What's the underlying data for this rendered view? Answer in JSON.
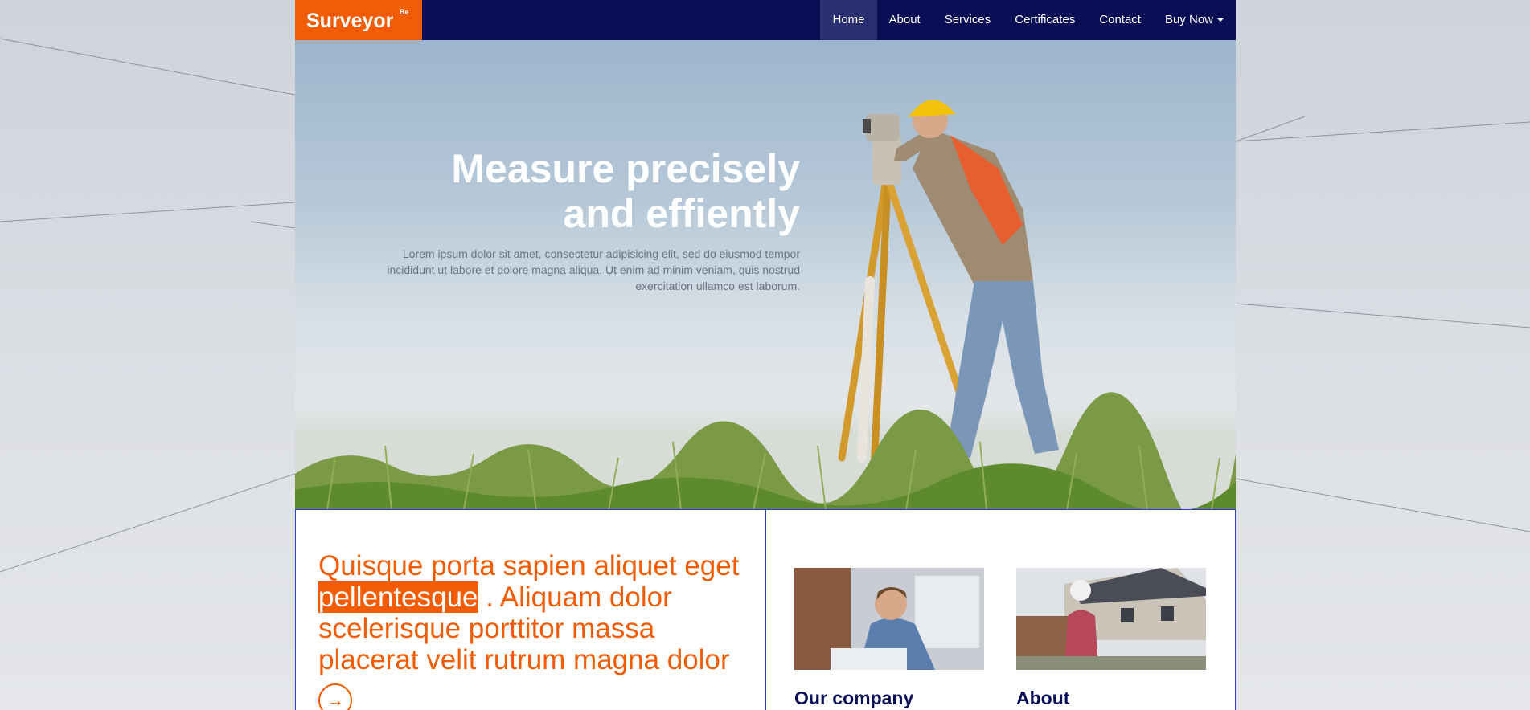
{
  "brand": {
    "name": "Surveyor",
    "superscript": "Be"
  },
  "nav": {
    "items": [
      {
        "label": "Home",
        "active": true
      },
      {
        "label": "About",
        "active": false
      },
      {
        "label": "Services",
        "active": false
      },
      {
        "label": "Certificates",
        "active": false
      },
      {
        "label": "Contact",
        "active": false
      },
      {
        "label": "Buy Now",
        "active": false,
        "dropdown": true
      }
    ]
  },
  "hero": {
    "title_line1": "Measure precisely",
    "title_line2": "and effiently",
    "text": "Lorem ipsum dolor sit amet, consectetur adipisicing elit, sed do eiusmod tempor incididunt ut labore et dolore magna aliqua. Ut enim ad minim veniam, quis nostrud exercitation ullamco est laborum."
  },
  "intro": {
    "text_before": "Quisque porta sapien aliquet eget",
    "highlight": "pellentesque",
    "text_after": " . Aliquam dolor scelerisque porttitor massa placerat velit rutrum magna dolor",
    "button_icon": "arrow-right-icon"
  },
  "cards": [
    {
      "title": "Our company"
    },
    {
      "title": "About"
    }
  ],
  "colors": {
    "accent": "#f25c05",
    "navy": "#0a0f55",
    "border": "#2d3ec7"
  }
}
